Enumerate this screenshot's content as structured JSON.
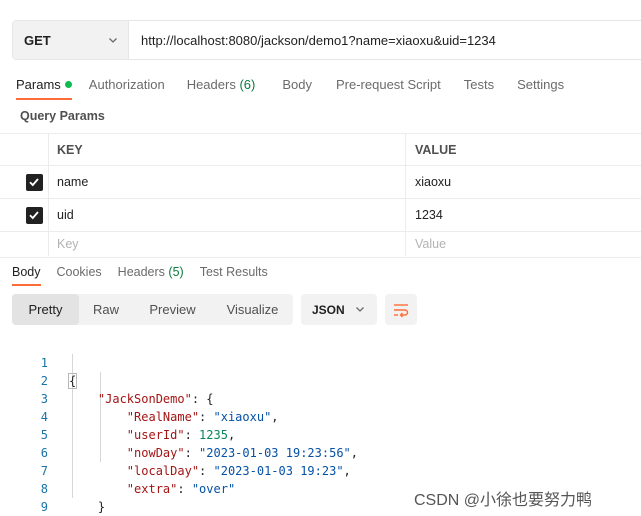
{
  "request": {
    "method": "GET",
    "url": "http://localhost:8080/jackson/demo1?name=xiaoxu&uid=1234"
  },
  "request_tabs": [
    {
      "label": "Params",
      "active": true,
      "has_dot": true
    },
    {
      "label": "Authorization"
    },
    {
      "label": "Headers",
      "count": "(6)"
    },
    {
      "label": "Body"
    },
    {
      "label": "Pre-request Script"
    },
    {
      "label": "Tests"
    },
    {
      "label": "Settings"
    }
  ],
  "query_params": {
    "title": "Query Params",
    "columns": {
      "key": "KEY",
      "value": "VALUE"
    },
    "rows": [
      {
        "key": "name",
        "value": "xiaoxu",
        "checked": true
      },
      {
        "key": "uid",
        "value": "1234",
        "checked": true
      }
    ],
    "placeholder": {
      "key": "Key",
      "value": "Value"
    }
  },
  "response_tabs": [
    {
      "label": "Body",
      "active": true
    },
    {
      "label": "Cookies"
    },
    {
      "label": "Headers",
      "count": "(5)"
    },
    {
      "label": "Test Results"
    }
  ],
  "view_modes": [
    "Pretty",
    "Raw",
    "Preview",
    "Visualize"
  ],
  "active_view_mode": "Pretty",
  "format": "JSON",
  "code": {
    "line_numbers": [
      "1",
      "2",
      "3",
      "4",
      "5",
      "6",
      "7",
      "8",
      "9"
    ],
    "root_key": "\"JackSonDemo\"",
    "fields": [
      {
        "key": "\"RealName\"",
        "value": "\"xiaoxu\"",
        "kind": "string"
      },
      {
        "key": "\"userId\"",
        "value": "1235",
        "kind": "number"
      },
      {
        "key": "\"nowDay\"",
        "value": "\"2023-01-03 19:23:56\"",
        "kind": "string"
      },
      {
        "key": "\"localDay\"",
        "value": "\"2023-01-03 19:23\"",
        "kind": "string"
      },
      {
        "key": "\"extra\"",
        "value": "\"over\"",
        "kind": "string"
      }
    ]
  },
  "watermark": "CSDN @小徐也要努力鸭",
  "colors": {
    "accent": "#ff6c37",
    "dot": "#0cbb52",
    "json_key": "#a31515",
    "json_string": "#0451a5",
    "json_number": "#098658"
  },
  "icons": [
    "chevron-down-icon",
    "checkmark-icon",
    "wrap-lines-icon"
  ]
}
